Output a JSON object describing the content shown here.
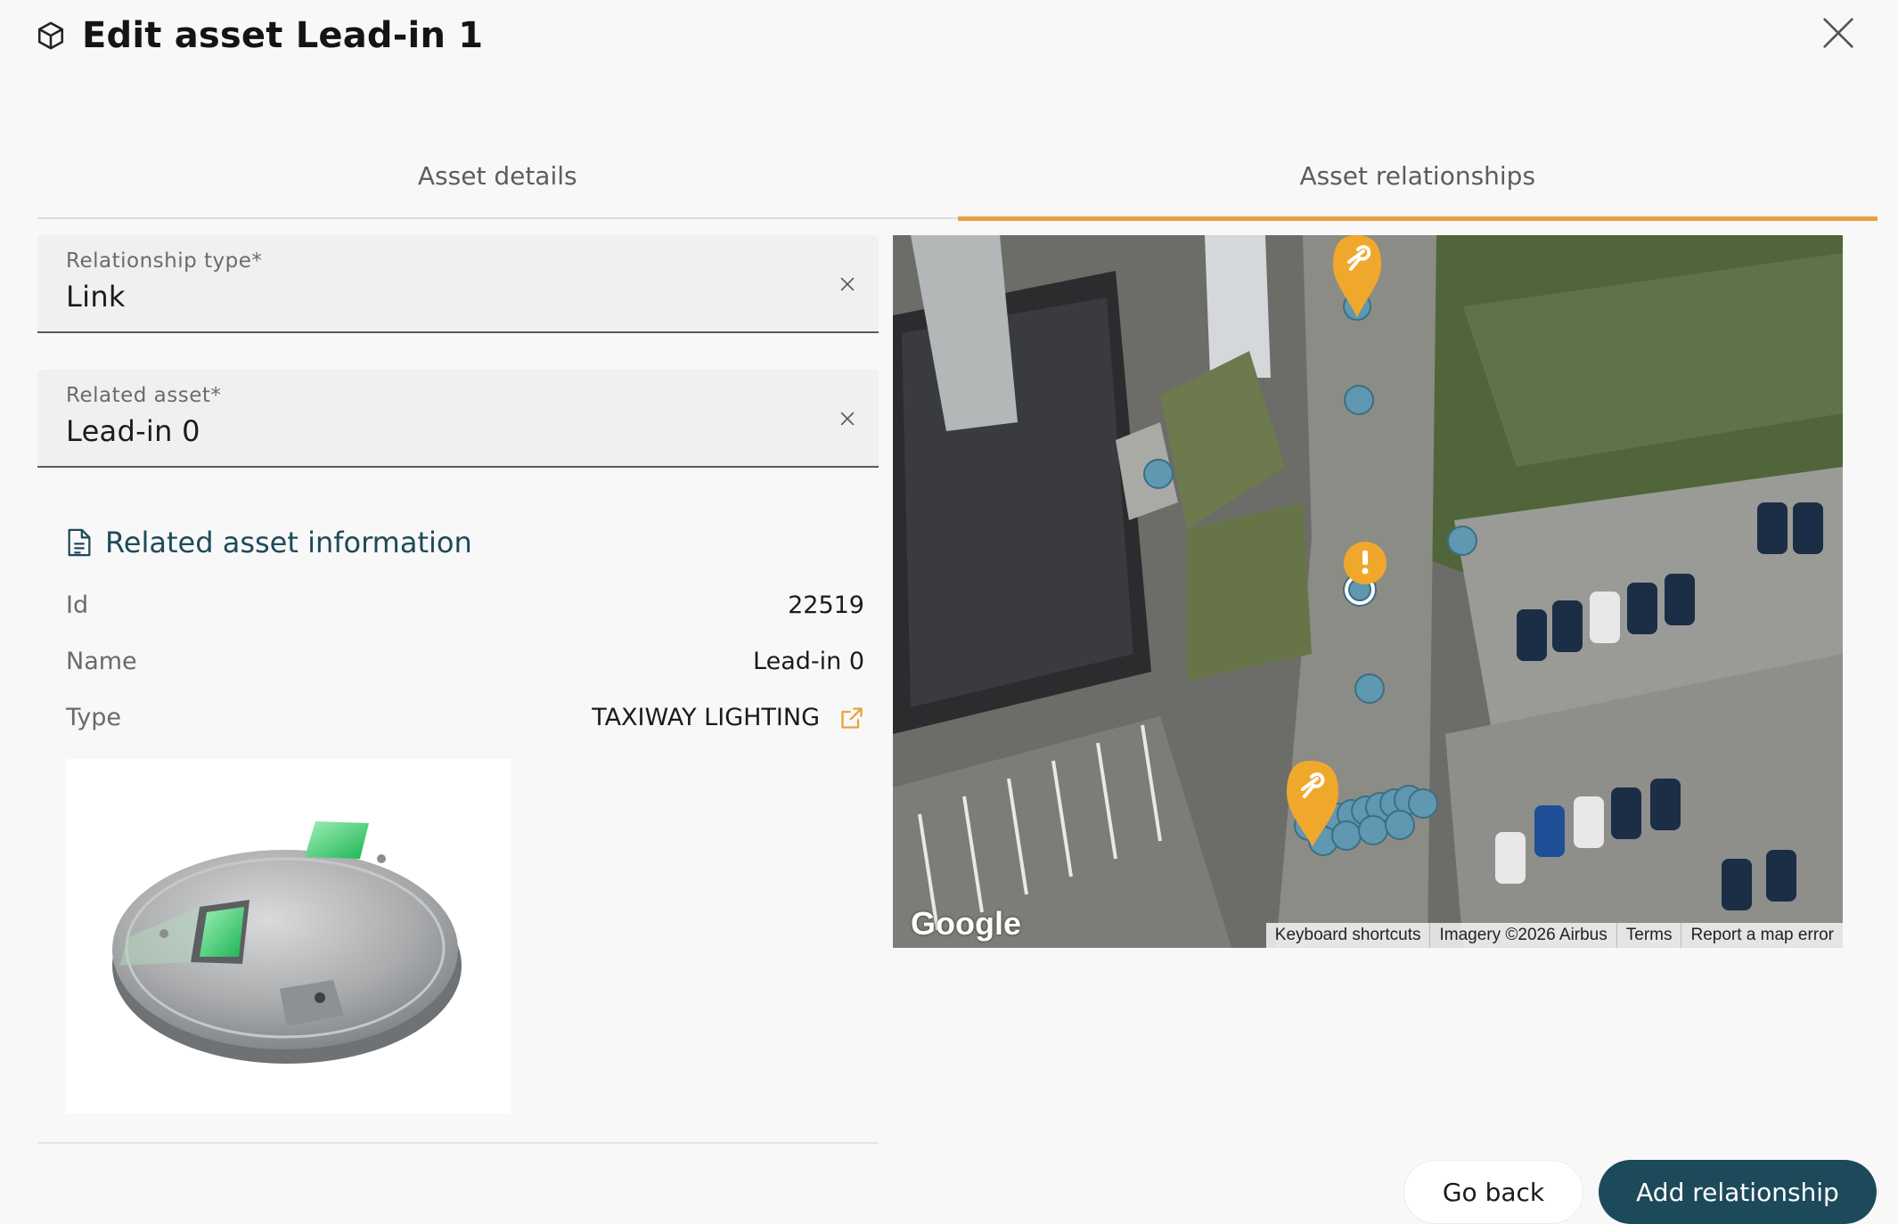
{
  "header": {
    "title": "Edit asset Lead-in 1",
    "icon": "cube-icon",
    "close_icon": "close-icon"
  },
  "tabs": [
    {
      "label": "Asset details",
      "active": false
    },
    {
      "label": "Asset relationships",
      "active": true
    }
  ],
  "form": {
    "relationship_type": {
      "label": "Relationship type*",
      "value": "Link"
    },
    "related_asset": {
      "label": "Related asset*",
      "value": "Lead-in 0"
    }
  },
  "info": {
    "title": "Related asset information",
    "icon": "document-icon",
    "rows": [
      {
        "key": "Id",
        "value": "22519"
      },
      {
        "key": "Name",
        "value": "Lead-in 0"
      },
      {
        "key": "Type",
        "value": "TAXIWAY LIGHTING"
      }
    ]
  },
  "map": {
    "brand": "Google",
    "attribution": [
      "Keyboard shortcuts",
      "Imagery ©2026 Airbus",
      "Terms",
      "Report a map error"
    ]
  },
  "buttons": {
    "back": "Go back",
    "add": "Add relationship"
  },
  "colors": {
    "accent": "#e8a33c",
    "primary": "#1d4a5a",
    "marker": "#5f98b0",
    "warning": "#f0a82c"
  }
}
